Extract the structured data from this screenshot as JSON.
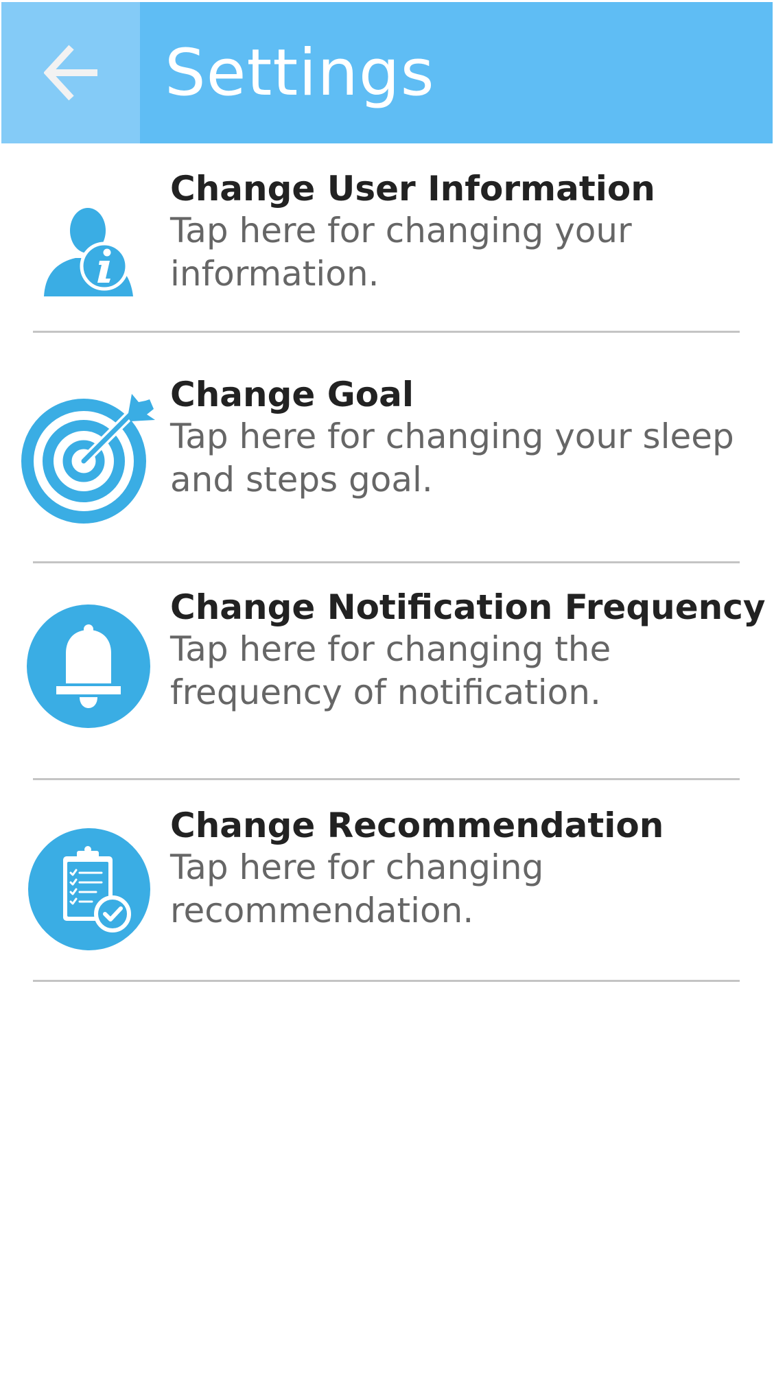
{
  "header": {
    "title": "Settings",
    "back_icon": "arrow-left-icon"
  },
  "colors": {
    "app_bar": "#5fbdf4",
    "back_button_bg": "#84cbf7",
    "icon_blue": "#3aade4",
    "title_text": "#222222",
    "desc_text": "#666666",
    "divider": "#c4c4c4"
  },
  "settings": {
    "items": [
      {
        "title": "Change User Information",
        "description": "Tap here for changing your information.",
        "icon": "user-info-icon"
      },
      {
        "title": "Change Goal",
        "description": "Tap here for changing your sleep and steps goal.",
        "icon": "target-icon"
      },
      {
        "title": "Change Notification Frequency",
        "description": "Tap here for changing the frequency of notification.",
        "icon": "bell-icon"
      },
      {
        "title": "Change Recommendation",
        "description": "Tap here for changing recommendation.",
        "icon": "clipboard-check-icon"
      }
    ]
  }
}
